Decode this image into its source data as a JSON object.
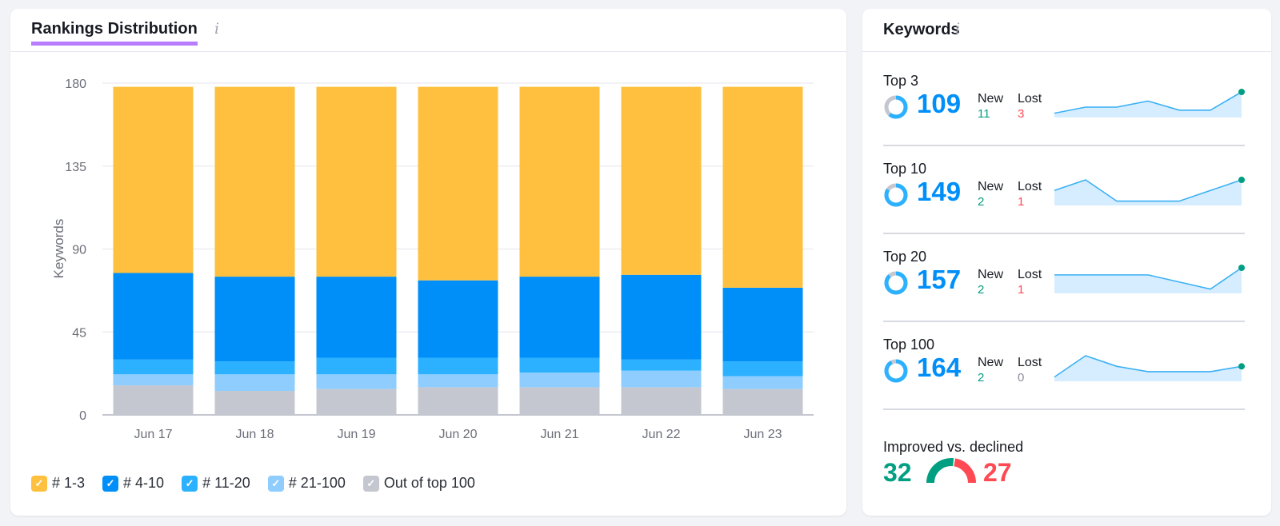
{
  "left_panel": {
    "title": "Rankings Distribution",
    "info_icon": "i"
  },
  "right_panel": {
    "title": "Keywords",
    "info_icon": "i"
  },
  "colors": {
    "r1_3": "#fec03e",
    "r4_10": "#008ff8",
    "r11_20": "#2bb1ff",
    "r21_100": "#8fcdff",
    "out": "#c4c7cf",
    "green": "#009f81",
    "red": "#ff4953",
    "blue": "#008ff8"
  },
  "chart_data": {
    "type": "bar",
    "stacked": true,
    "title": "Rankings Distribution",
    "xlabel": "",
    "ylabel": "Keywords",
    "ylim": [
      0,
      180
    ],
    "yticks": [
      0,
      45,
      90,
      135,
      180
    ],
    "grid": true,
    "legend_position": "bottom-left",
    "categories": [
      "Jun 17",
      "Jun 18",
      "Jun 19",
      "Jun 20",
      "Jun 21",
      "Jun 22",
      "Jun 23"
    ],
    "series": [
      {
        "name": "Out of top 100",
        "key": "out",
        "values": [
          16,
          13,
          14,
          15,
          15,
          15,
          14
        ]
      },
      {
        "name": "# 21-100",
        "key": "r21_100",
        "values": [
          6,
          9,
          8,
          7,
          8,
          9,
          7
        ]
      },
      {
        "name": "# 11-20",
        "key": "r11_20",
        "values": [
          8,
          7,
          9,
          9,
          8,
          6,
          8
        ]
      },
      {
        "name": "# 4-10",
        "key": "r4_10",
        "values": [
          47,
          46,
          44,
          42,
          44,
          46,
          40
        ]
      },
      {
        "name": "# 1-3",
        "key": "r1_3",
        "values": [
          101,
          103,
          103,
          105,
          103,
          102,
          109
        ]
      }
    ]
  },
  "legend": [
    {
      "label": "# 1-3",
      "key": "r1_3"
    },
    {
      "label": "# 4-10",
      "key": "r4_10"
    },
    {
      "label": "# 11-20",
      "key": "r11_20"
    },
    {
      "label": "# 21-100",
      "key": "r21_100"
    },
    {
      "label": "Out of top 100",
      "key": "out"
    }
  ],
  "keywords": [
    {
      "label": "Top 3",
      "value": "109",
      "share": 0.61,
      "new_label": "New",
      "new": "11",
      "lost_label": "Lost",
      "lost": "3",
      "lost_color": "red",
      "trend": [
        102,
        104,
        104,
        106,
        103,
        103,
        109
      ]
    },
    {
      "label": "Top 10",
      "value": "149",
      "share": 0.84,
      "new_label": "New",
      "new": "2",
      "lost_label": "Lost",
      "lost": "1",
      "lost_color": "red",
      "trend": [
        146,
        149,
        143,
        143,
        143,
        146,
        149
      ]
    },
    {
      "label": "Top 20",
      "value": "157",
      "share": 0.88,
      "new_label": "New",
      "new": "2",
      "lost_label": "Lost",
      "lost": "1",
      "lost_color": "red",
      "trend": [
        156,
        156,
        156,
        156,
        155,
        154,
        157
      ]
    },
    {
      "label": "Top 100",
      "value": "164",
      "share": 0.92,
      "new_label": "New",
      "new": "2",
      "lost_label": "Lost",
      "lost": "0",
      "lost_color": "gray",
      "trend": [
        162,
        166,
        164,
        163,
        163,
        163,
        164
      ]
    }
  ],
  "improved": {
    "label": "Improved vs. declined",
    "improved": "32",
    "declined": "27",
    "improved_value": 32,
    "declined_value": 27
  }
}
